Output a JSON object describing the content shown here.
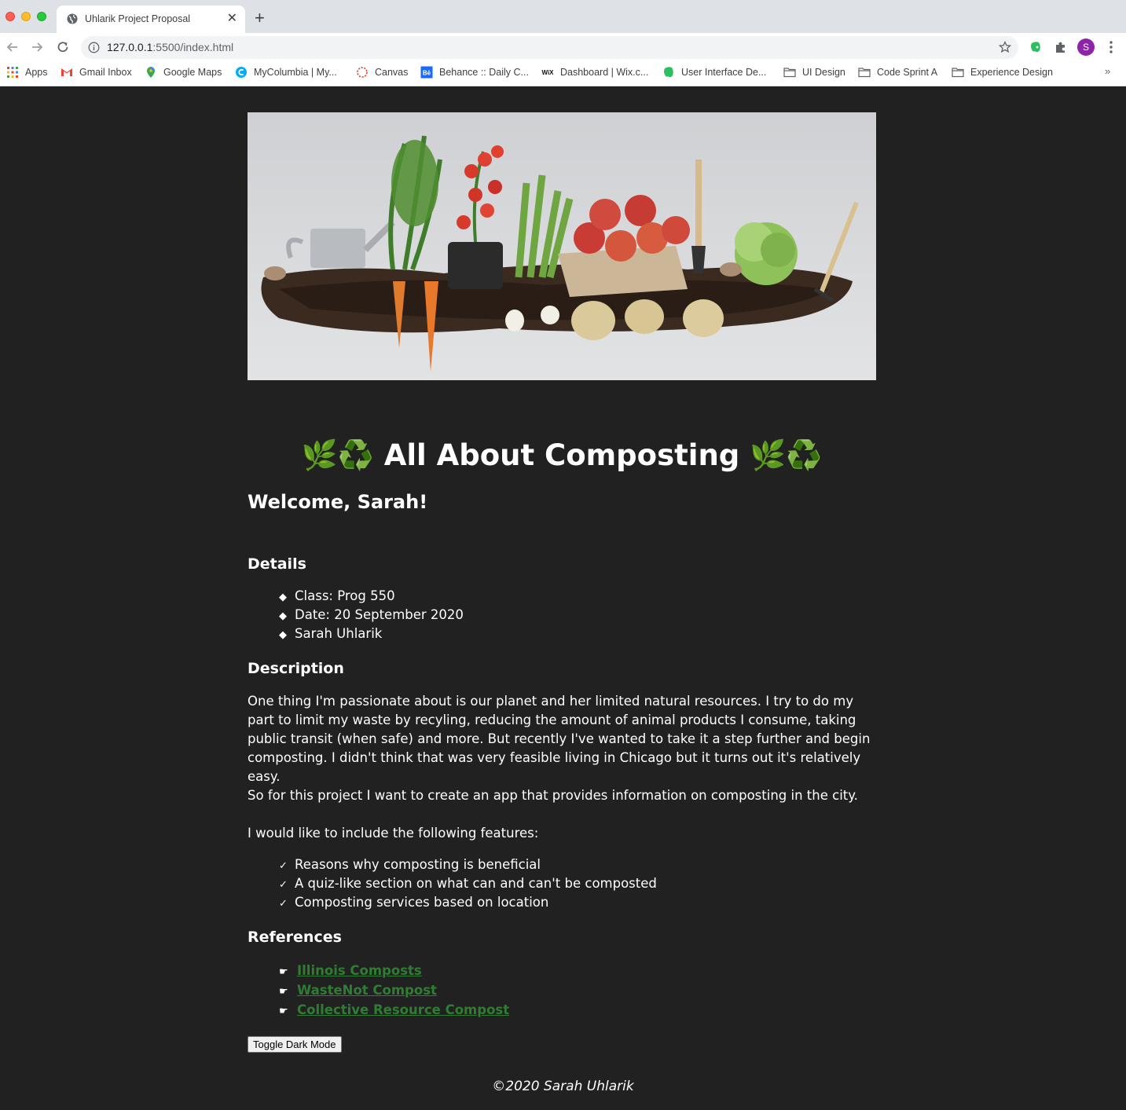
{
  "browser": {
    "tab_title": "Uhlarik Project Proposal",
    "new_tab_label": "+",
    "tab_close_label": "✕",
    "url_host": "127.0.0.1",
    "url_path": ":5500/index.html",
    "profile_initial": "S",
    "bookmarks": [
      {
        "label": "Apps",
        "icon": "apps-grid-icon"
      },
      {
        "label": "Gmail Inbox",
        "icon": "gmail-icon"
      },
      {
        "label": "Google Maps",
        "icon": "maps-icon"
      },
      {
        "label": "MyColumbia | My...",
        "icon": "columbia-icon"
      },
      {
        "label": "Canvas",
        "icon": "canvas-icon"
      },
      {
        "label": "Behance :: Daily C...",
        "icon": "behance-icon"
      },
      {
        "label": "Dashboard | Wix.c...",
        "icon": "wix-icon"
      },
      {
        "label": "User Interface De...",
        "icon": "evernote-icon"
      },
      {
        "label": "UI Design",
        "icon": "folder-icon"
      },
      {
        "label": "Code Sprint A",
        "icon": "folder-icon"
      },
      {
        "label": "Experience Design",
        "icon": "folder-icon"
      }
    ],
    "bookmarks_overflow": "»"
  },
  "page": {
    "title": "🌿♻️ All About Composting 🌿♻️",
    "welcome": "Welcome, Sarah!",
    "details_heading": "Details",
    "details": [
      "Class: Prog 550",
      "Date: 20 September 2020",
      "Sarah Uhlarik"
    ],
    "description_heading": "Description",
    "paragraphs": [
      "One thing I'm passionate about is our planet and her limited natural resources. I try to do my part to limit my waste by recyling, reducing the amount of animal products I consume, taking public transit (when safe) and more. But recently I've wanted to take it a step further and begin composting. I didn't think that was very feasible living in Chicago but it turns out it's relatively easy.",
      "So for this project I want to create an app that provides information on composting in the city.",
      "I would like to include the following features:"
    ],
    "features": [
      "Reasons why composting is beneficial",
      "A quiz-like section on what can and can't be composted",
      "Composting services based on location"
    ],
    "references_heading": "References",
    "references": [
      "Illinois Composts",
      "WasteNot Compost",
      "Collective Resource Compost"
    ],
    "toggle_button": "Toggle Dark Mode",
    "footer": "©2020 Sarah Uhlarik",
    "detail_bullet": "◆",
    "feature_bullet": "✓",
    "reference_bullet": "☛"
  },
  "colors": {
    "page_background": "#212121",
    "link_green": "#2e7d32",
    "profile_purple": "#8e24aa"
  }
}
